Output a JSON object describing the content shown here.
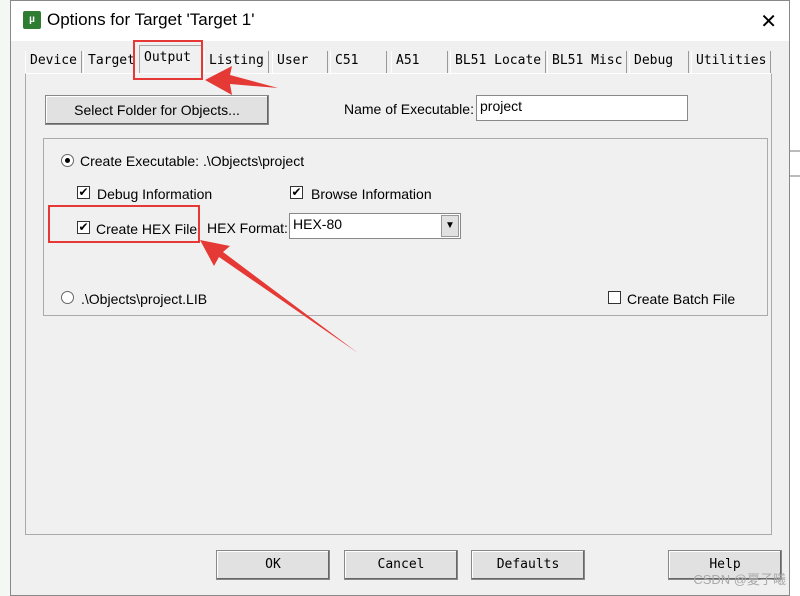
{
  "window": {
    "title": "Options for Target 'Target 1'",
    "icon": "keil-uvision-icon"
  },
  "tabs": [
    {
      "label": "Device"
    },
    {
      "label": "Target"
    },
    {
      "label": "Output",
      "active": true
    },
    {
      "label": "Listing"
    },
    {
      "label": "User"
    },
    {
      "label": "C51"
    },
    {
      "label": "A51"
    },
    {
      "label": "BL51 Locate"
    },
    {
      "label": "BL51 Misc"
    },
    {
      "label": "Debug"
    },
    {
      "label": "Utilities"
    }
  ],
  "output": {
    "select_folder_label": "Select Folder for Objects...",
    "name_of_exe_label": "Name of Executable:",
    "name_of_exe_value": "project",
    "create_exe_label": "Create Executable:  .\\Objects\\project",
    "create_exe_selected": true,
    "debug_info_label": "Debug Information",
    "debug_info_checked": true,
    "browse_info_label": "Browse Information",
    "browse_info_checked": true,
    "create_hex_label": "Create HEX File",
    "create_hex_checked": true,
    "hex_format_label": "HEX Format:",
    "hex_format_value": "HEX-80",
    "lib_label": ".\\Objects\\project.LIB",
    "lib_selected": false,
    "batch_label": "Create Batch File",
    "batch_checked": false
  },
  "buttons": {
    "ok": "OK",
    "cancel": "Cancel",
    "defaults": "Defaults",
    "help": "Help"
  },
  "watermark": "CSDN @夏子曦",
  "annotation_color": "#e53935"
}
